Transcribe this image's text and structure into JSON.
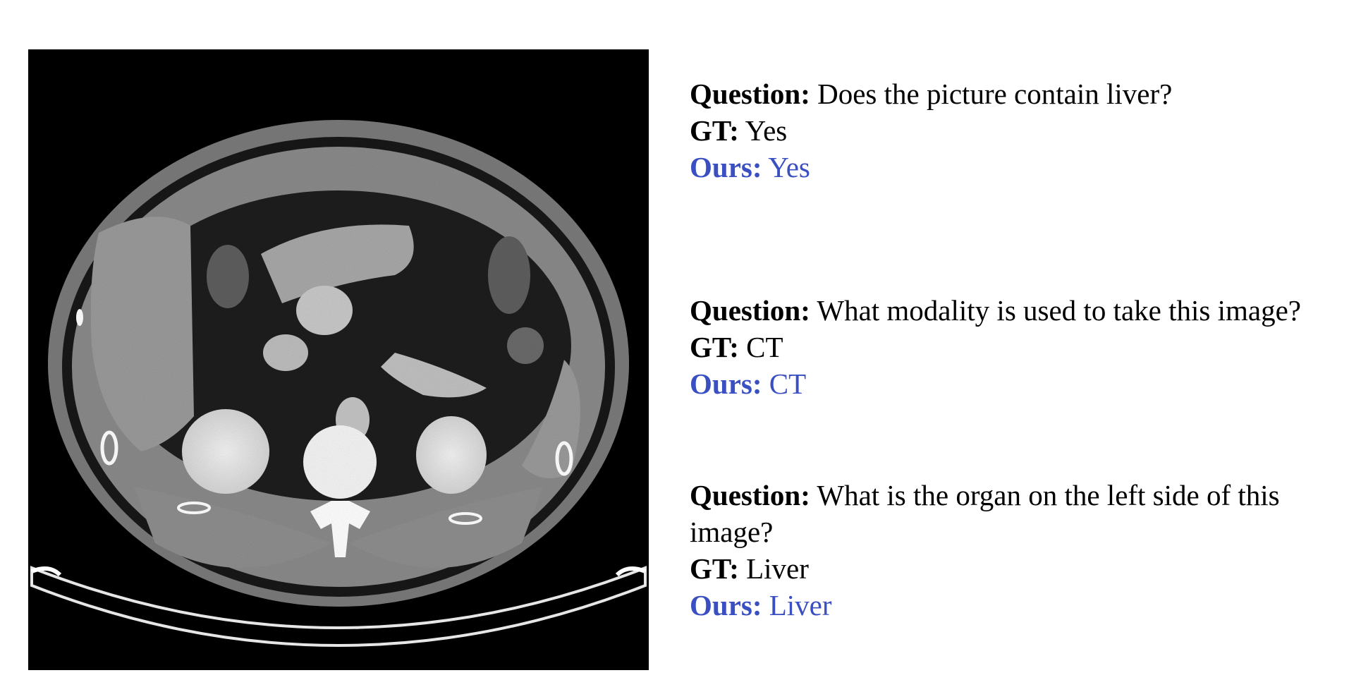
{
  "labels": {
    "question": "Question:",
    "gt": "GT:",
    "ours": "Ours:"
  },
  "colors": {
    "ours_text": "#3a4fc2",
    "text": "#000000",
    "background": "#ffffff"
  },
  "image": {
    "alt": "CT abdominal scan"
  },
  "qa": [
    {
      "question": "Does the picture contain liver?",
      "gt": "Yes",
      "ours": "Yes"
    },
    {
      "question": "What modality is used to take this image?",
      "gt": "CT",
      "ours": "CT"
    },
    {
      "question": "What is the organ on the left side of this image?",
      "gt": "Liver",
      "ours": "Liver"
    }
  ]
}
